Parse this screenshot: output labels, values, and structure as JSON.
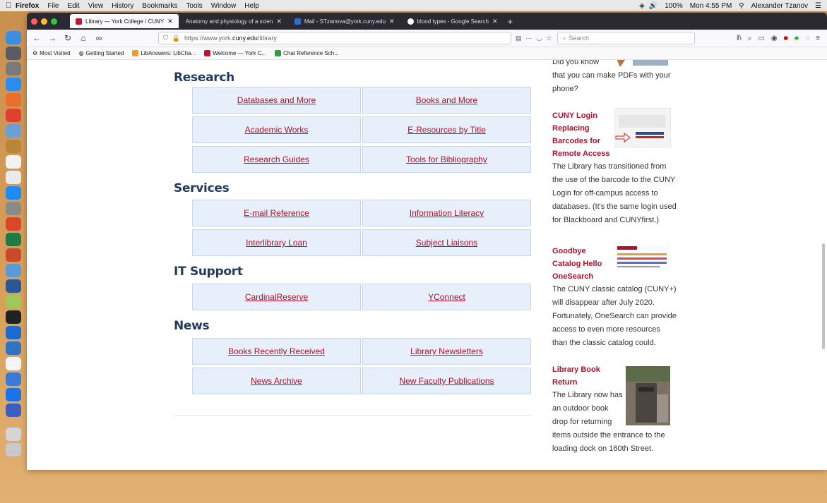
{
  "menubar": {
    "app": "Firefox",
    "items": [
      "File",
      "Edit",
      "View",
      "History",
      "Bookmarks",
      "Tools",
      "Window",
      "Help"
    ],
    "battery": "100%",
    "clock": "Mon 4:55 PM",
    "user": "Alexander Tzanov"
  },
  "tabs": [
    {
      "title": "Library — York College / CUNY",
      "active": true,
      "favicon_color": "#c4122f"
    },
    {
      "title": "Anatomy and physiology of a scien",
      "active": false,
      "favicon_color": ""
    },
    {
      "title": "Mail - STzanova@york.cuny.edu",
      "active": false,
      "favicon_color": "#2a6fd6"
    },
    {
      "title": "blood types - Google Search",
      "active": false,
      "favicon_color": "#ffffff"
    }
  ],
  "address": {
    "url_prefix": "https://www.york.",
    "url_host": "cuny.edu",
    "url_path": "/library",
    "search_placeholder": "Search"
  },
  "bookmarks": [
    {
      "label": "Most Visited",
      "icon": "gear-icon",
      "color": "#777"
    },
    {
      "label": "Getting Started",
      "icon": "firefox-icon",
      "color": "#e66000"
    },
    {
      "label": "LibAnswers: LibCha...",
      "icon": "libanswers-icon",
      "color": "#f0a020"
    },
    {
      "label": "Welcome — York C...",
      "icon": "york-shield-icon",
      "color": "#c4122f"
    },
    {
      "label": "Chat Reference Sch...",
      "icon": "plus-icon",
      "color": "#2e9e3e"
    }
  ],
  "sections": [
    {
      "title": "Research",
      "links": [
        "Databases and More",
        "Books and More",
        "Academic Works",
        "E-Resources by Title",
        "Research Guides",
        "Tools for Bibliography"
      ]
    },
    {
      "title": "Services",
      "links": [
        "E-mail Reference",
        "Information Literacy",
        "Interlibrary Loan",
        "Subject Liaisons"
      ]
    },
    {
      "title": "IT Support",
      "links": [
        "CardinalReserve",
        "YConnect"
      ]
    },
    {
      "title": "News",
      "links": [
        "Books Recently Received",
        "Library Newsletters",
        "News Archive",
        "New Faculty Publications"
      ]
    }
  ],
  "sidebar": {
    "pdf_tip": {
      "l1": "Did you know",
      "l2": "that you can make PDFs with your",
      "l3": "phone?"
    },
    "cuny_login": {
      "title_lines": [
        "CUNY Login",
        "Replacing",
        "Barcodes for",
        "Remote Access"
      ],
      "body_lines": [
        "The Library has transitioned from",
        "the use of the barcode to the CUNY",
        "Login for off-campus access to",
        "databases. (It's the same login used",
        "for Blackboard and CUNYfirst.)"
      ]
    },
    "onesearch": {
      "title_lines": [
        "Goodbye",
        "Catalog Hello",
        "OneSearch"
      ],
      "body_lines": [
        "The CUNY classic catalog (CUNY+)",
        "will disappear after July 2020.",
        "Fortunately, OneSearch can provide",
        "access to even more resources",
        "than the classic catalog could."
      ]
    },
    "book_return": {
      "title_lines": [
        "Library Book",
        "Return"
      ],
      "body_lines": [
        "The Library now has",
        "an outdoor book",
        "drop for returning",
        "items outside the entrance to the",
        "loading dock on 160th Street."
      ]
    }
  },
  "colors": {
    "accent": "#b0102a",
    "heading": "#223a5c",
    "cell_bg": "#e7f0fa"
  }
}
